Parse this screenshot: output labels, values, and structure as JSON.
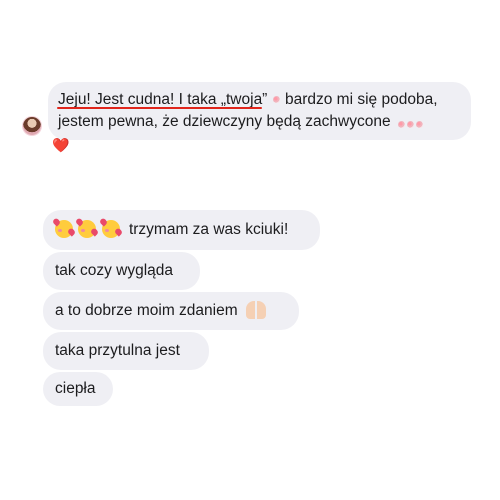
{
  "incoming_message": {
    "line1_pre": "Jeju! Jest cudna! I taka „twoja”",
    "line1_post": "bardzo mi się podoba,",
    "line2": "jestem pewna, że dziewczyny będą zachwycone",
    "reaction": "❤️"
  },
  "outgoing_messages": [
    {
      "text": "trzymam za was kciuki!"
    },
    {
      "text": "tak cozy wygląda"
    },
    {
      "text": "a to dobrze moim zdaniem"
    },
    {
      "text": "taka przytulna jest"
    },
    {
      "text": "ciepła"
    }
  ],
  "colors": {
    "bubble": "#efeff4",
    "underline": "#e0251b",
    "heart": "#e0251b"
  },
  "icons": [
    "avatar",
    "smiling-face-with-hearts-icon",
    "raising-hands-icon",
    "heart-reaction-icon"
  ]
}
